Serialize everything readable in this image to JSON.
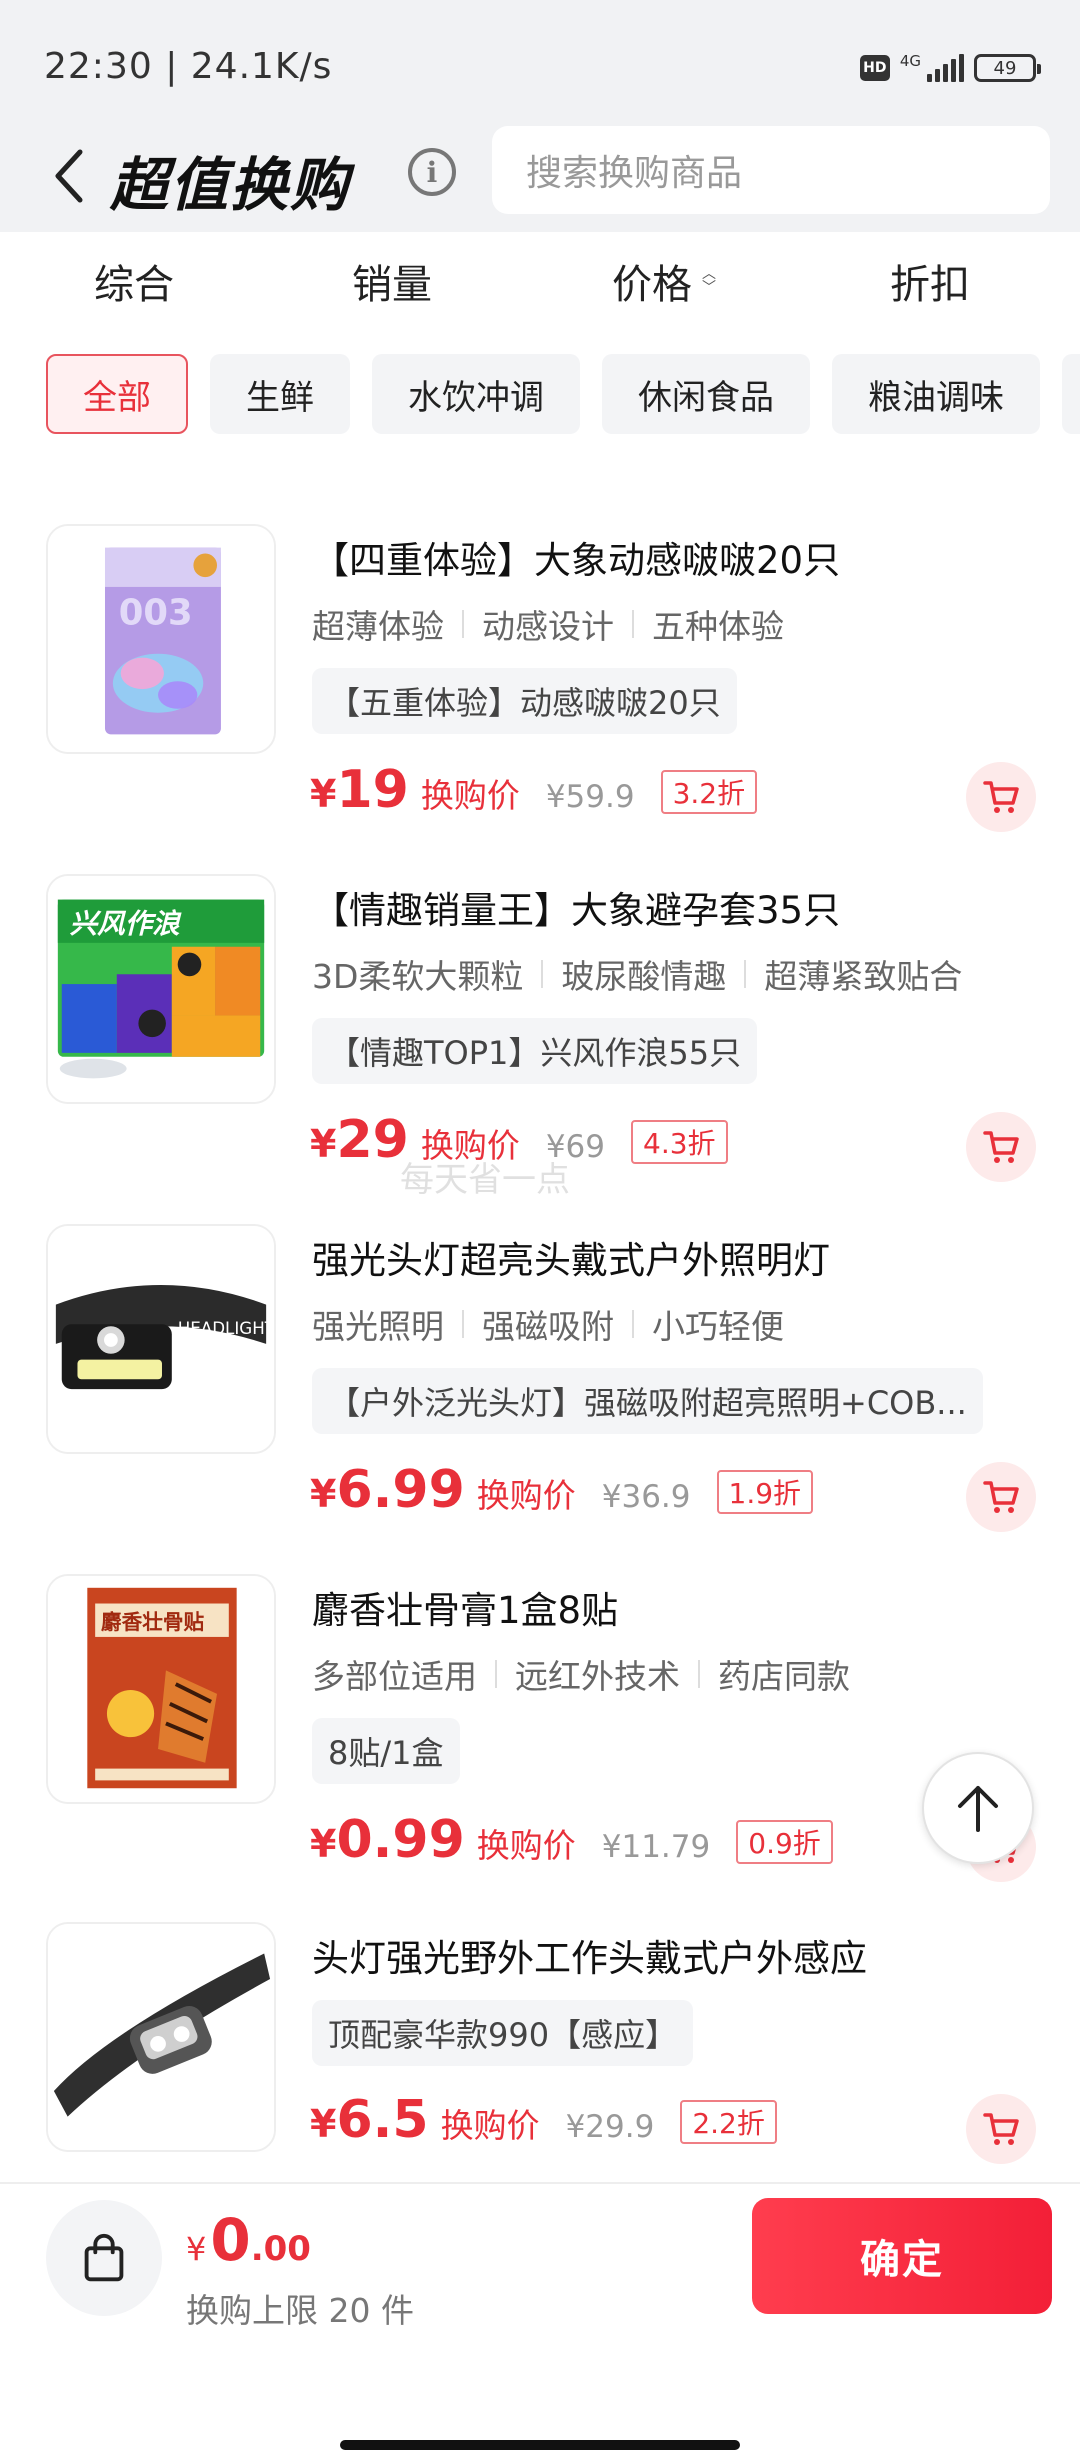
{
  "status_bar": {
    "time": "22:30 | 24.1K/s",
    "hd": "HD",
    "network": "4G",
    "battery": "49"
  },
  "header": {
    "title": "超值换购",
    "info_icon": "info-icon",
    "search_placeholder": "搜索换购商品"
  },
  "sort_tabs": [
    {
      "label": "综合"
    },
    {
      "label": "销量"
    },
    {
      "label": "价格"
    },
    {
      "label": "折扣"
    }
  ],
  "categories": [
    {
      "label": "全部",
      "active": true
    },
    {
      "label": "生鲜"
    },
    {
      "label": "水饮冲调"
    },
    {
      "label": "休闲食品"
    },
    {
      "label": "粮油调味"
    }
  ],
  "products": [
    {
      "title": "【四重体验】大象动感啵啵20只",
      "tags": [
        "超薄体验",
        "动感设计",
        "五种体验"
      ],
      "spec": "【五重体验】动感啵啵20只",
      "currency": "¥",
      "price": "19",
      "swap_label": "换购价",
      "original": "¥59.9",
      "discount": "3.2折"
    },
    {
      "title": "【情趣销量王】大象避孕套35只",
      "tags": [
        "3D柔软大颗粒",
        "玻尿酸情趣",
        "超薄紧致贴合"
      ],
      "spec": "【情趣TOP1】兴风作浪55只",
      "currency": "¥",
      "price": "29",
      "swap_label": "换购价",
      "original": "¥69",
      "discount": "4.3折",
      "image_text": "兴风作浪"
    },
    {
      "title": "强光头灯超亮头戴式户外照明灯",
      "tags": [
        "强光照明",
        "强磁吸附",
        "小巧轻便"
      ],
      "spec": "【户外泛光头灯】强磁吸附超亮照明+COB...",
      "currency": "¥",
      "price": "6.99",
      "swap_label": "换购价",
      "original": "¥36.9",
      "discount": "1.9折",
      "image_text": "HEADLIGHT"
    },
    {
      "title": "麝香壮骨膏1盒8贴",
      "tags": [
        "多部位适用",
        "远红外技术",
        "药店同款"
      ],
      "spec": "8贴/1盒",
      "currency": "¥",
      "price": "0.99",
      "swap_label": "换购价",
      "original": "¥11.79",
      "discount": "0.9折",
      "image_text": "麝香壮骨贴"
    },
    {
      "title": "头灯强光野外工作头戴式户外感应",
      "tags": [],
      "spec": "顶配豪华款990【感应】",
      "currency": "¥",
      "price": "6.5",
      "swap_label": "换购价",
      "original": "¥29.9",
      "discount": "2.2折"
    }
  ],
  "watermark": "每天省一点",
  "bottom_bar": {
    "currency": "¥",
    "total_int": "0",
    "total_dec": ".00",
    "limit_text": "换购上限 20 件",
    "confirm_label": "确定"
  },
  "colors": {
    "accent": "#e8303a",
    "header_bg": "#f1f2f4",
    "chip_bg": "#f3f4f6",
    "cart_bg": "#fdeaea"
  }
}
